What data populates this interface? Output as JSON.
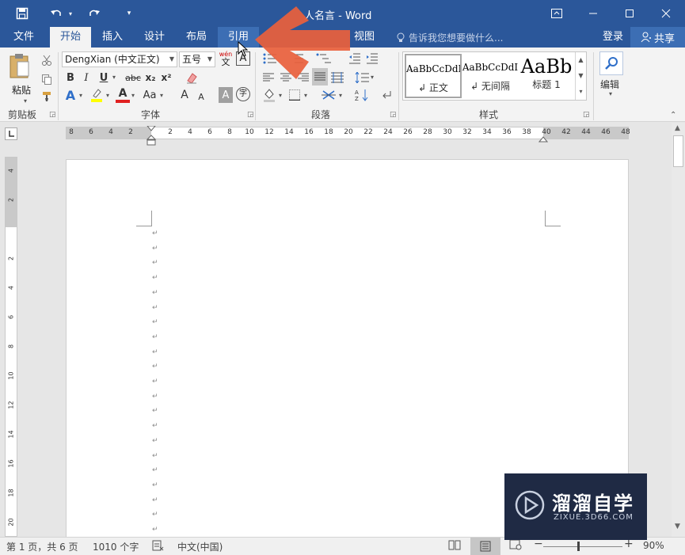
{
  "window": {
    "title_suffix": "人名言 - Word",
    "minimize_icon": "minimize-icon",
    "maximize_icon": "maximize-icon",
    "close_icon": "close-icon"
  },
  "qat": {
    "save": "save-icon",
    "undo": "undo-icon",
    "redo": "redo-icon",
    "customize": "customize-icon"
  },
  "tabs": [
    {
      "label": "文件"
    },
    {
      "label": "开始"
    },
    {
      "label": "插入"
    },
    {
      "label": "设计"
    },
    {
      "label": "布局"
    },
    {
      "label": "引用"
    },
    {
      "label": "视图"
    }
  ],
  "tell_me": "告诉我您想要做什么...",
  "account": {
    "login": "登录",
    "share": "共享"
  },
  "ribbon": {
    "clipboard": {
      "paste": "粘贴",
      "group": "剪贴板"
    },
    "font": {
      "name": "DengXian (中文正文)",
      "size": "五号",
      "group": "字体",
      "phonetic": "wén",
      "phonetic_char": "文",
      "bold": "B",
      "italic": "I",
      "underline": "U",
      "strike": "abc",
      "sub": "x₂",
      "sup": "x²",
      "color_a": "A",
      "case": "Aa",
      "grow": "A",
      "shrink": "A",
      "char_shade": "A",
      "enclose": "字",
      "border_a": "A"
    },
    "paragraph": {
      "group": "段落"
    },
    "styles": {
      "group": "样式",
      "items": [
        {
          "sample": "AaBbCcDdI",
          "name": "↲ 正文"
        },
        {
          "sample": "AaBbCcDdI",
          "name": "↲ 无间隔"
        },
        {
          "sample": "AaBb",
          "name": "标题 1"
        }
      ]
    },
    "editing": {
      "label": "编辑"
    }
  },
  "ruler": {
    "ticks": [
      "8",
      "6",
      "4",
      "2",
      "",
      "2",
      "4",
      "6",
      "8",
      "10",
      "12",
      "14",
      "16",
      "18",
      "20",
      "22",
      "24",
      "26",
      "28",
      "30",
      "32",
      "34",
      "36",
      "38",
      "40",
      "42",
      "44",
      "46",
      "48"
    ],
    "vticks": [
      "4",
      "2",
      "",
      "2",
      "4",
      "6",
      "8",
      "10",
      "12",
      "14",
      "16",
      "18",
      "20"
    ]
  },
  "document": {
    "paragraph_mark": "↵",
    "line_count": 21
  },
  "status": {
    "page": "第 1 页，共 6 页",
    "words": "1010 个字",
    "language": "中文(中国)",
    "zoom": "90%",
    "zoom_minus": "−",
    "zoom_plus": "+"
  },
  "watermark": {
    "brand": "溜溜自学",
    "url": "ZIXUE.3D66.COM"
  },
  "colors": {
    "title_blue": "#2b579a",
    "arrow": "#e8603c",
    "highlight": "#ffff00",
    "font_red": "#e02020"
  }
}
